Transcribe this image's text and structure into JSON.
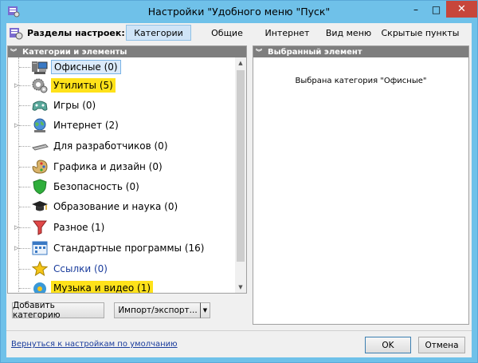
{
  "window": {
    "title": "Настройки \"Удобного меню \"Пуск\"",
    "minimize": "–",
    "maximize": "□",
    "close": "✕"
  },
  "toolbar": {
    "label": "Разделы настроек:",
    "tabs": [
      {
        "label": "Категории",
        "active": true
      },
      {
        "label": "Общие"
      },
      {
        "label": "Интернет"
      },
      {
        "label": "Вид меню"
      },
      {
        "label": "Скрытые пункты"
      }
    ]
  },
  "left_panel": {
    "header": "Категории и элементы",
    "tree": [
      {
        "label": "Офисные (0)",
        "icon": "office-icon",
        "expandable": false,
        "state": "selected"
      },
      {
        "label": "Утилиты (5)",
        "icon": "gears-icon",
        "expandable": true,
        "state": "highlight"
      },
      {
        "label": "Игры (0)",
        "icon": "gamepad-icon",
        "expandable": false
      },
      {
        "label": "Интернет (2)",
        "icon": "internet-globe-icon",
        "expandable": true
      },
      {
        "label": "Для разработчиков (0)",
        "icon": "keyboard-icon",
        "expandable": false
      },
      {
        "label": "Графика и дизайн (0)",
        "icon": "palette-icon",
        "expandable": false
      },
      {
        "label": "Безопасность (0)",
        "icon": "shield-icon",
        "expandable": false
      },
      {
        "label": "Образование и наука (0)",
        "icon": "graduation-cap-icon",
        "expandable": false
      },
      {
        "label": "Разное (1)",
        "icon": "funnel-icon",
        "expandable": true
      },
      {
        "label": "Стандартные программы (16)",
        "icon": "calendar-icon",
        "expandable": true
      },
      {
        "label": "Ссылки (0)",
        "icon": "star-icon",
        "expandable": false,
        "state": "link"
      },
      {
        "label": "Музыка и видео (1)",
        "icon": "media-icon",
        "expandable": false,
        "state": "highlight"
      }
    ],
    "scroll_up": "▲",
    "scroll_down": "▼"
  },
  "right_panel": {
    "header": "Выбранный элемент",
    "text": "Выбрана категория \"Офисные\""
  },
  "buttons": {
    "add_category": "Добавить категорию",
    "import_export": "Импорт/экспорт...",
    "import_arrow": "▼",
    "reset_link": "Вернуться к настройкам по умолчанию",
    "ok": "OK",
    "cancel": "Отмена"
  },
  "colors": {
    "titlebar": "#6fc1e9",
    "close": "#c7463b",
    "highlight": "#ffe21a",
    "link": "#1a3c9c",
    "panel_header": "#7e7e7e"
  }
}
